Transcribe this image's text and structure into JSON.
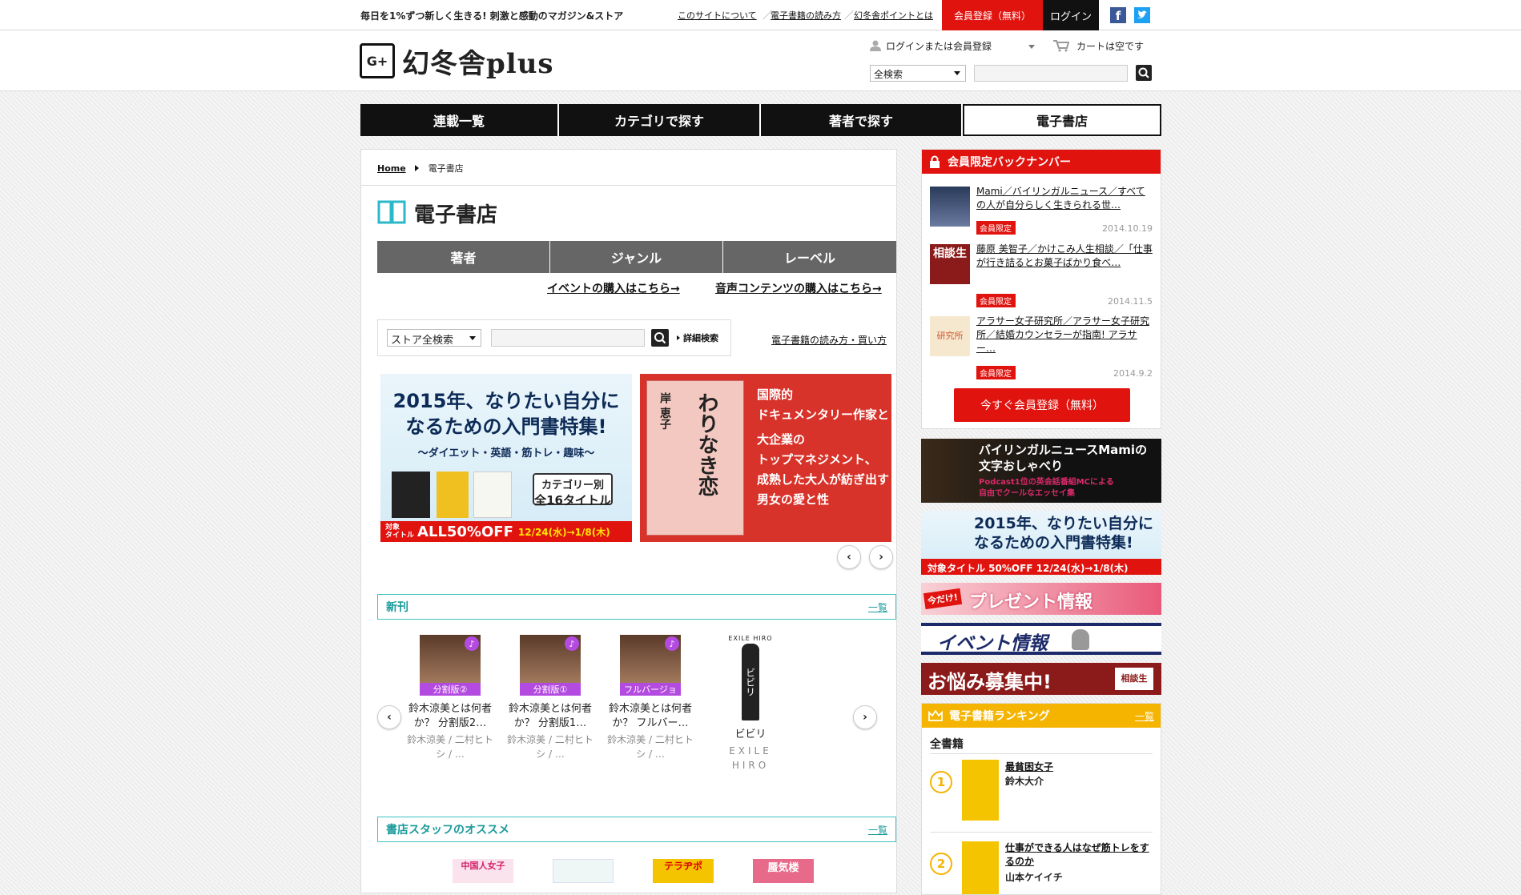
{
  "topbar": {
    "tagline": "毎日を1%ずつ新しく生きる! 刺激と感動のマガジン&ストア",
    "links": [
      "このサイトについて",
      "電子書籍の読み方",
      "幻冬舎ポイントとは"
    ],
    "register": "会員登録（無料）",
    "login": "ログイン"
  },
  "header": {
    "logo_text": "幻冬舎plus",
    "logo_mark": "G+",
    "user_menu": "ログインまたは会員登録",
    "cart": "カートは空です",
    "search_scope": "全検索",
    "search_value": ""
  },
  "nav": {
    "items": [
      "連載一覧",
      "カテゴリで探す",
      "著者で探す",
      "電子書店"
    ],
    "active": 3
  },
  "breadcrumb": {
    "home": "Home",
    "current": "電子書店"
  },
  "page": {
    "title": "電子書店",
    "tabs": [
      "著者",
      "ジャンル",
      "レーベル"
    ],
    "event_link": "イベントの購入はこちら→",
    "audio_link": "音声コンテンツの購入はこちら→",
    "store_search_scope": "ストア全検索",
    "store_search_value": "",
    "advanced_search": "詳細検索",
    "howto_link": "電子書籍の読み方・買い方"
  },
  "carousel": {
    "banner1": {
      "line1": "2015年、なりたい自分に",
      "line2": "なるための入門書特集!",
      "line3": "～ダイエット・英語・筋トレ・趣味～",
      "badge1": "カテゴリー別",
      "badge2": "全16タイトル",
      "sale_left1": "対象",
      "sale_left2": "タイトル",
      "sale": "ALL50%OFF",
      "dates": "12/24(水)→1/8(木)"
    },
    "banner2": {
      "author": "岸 恵子",
      "book": "わりなき恋",
      "lines": [
        "国際的",
        "ドキュメンタリー作家と",
        "大企業の",
        "トップマネジメント、",
        "成熟した大人が紡ぎ出す",
        "男女の愛と性"
      ]
    }
  },
  "shinkan": {
    "title": "新刊",
    "more": "一覧",
    "books": [
      {
        "label": "分割版②",
        "title": "鈴木涼美とは何者か？ 分割版2…",
        "author": "鈴木涼美 / 二村ヒトシ / …"
      },
      {
        "label": "分割版①",
        "title": "鈴木涼美とは何者か？ 分割版1…",
        "author": "鈴木涼美 / 二村ヒトシ / …"
      },
      {
        "label": "フルバージョン",
        "title": "鈴木涼美とは何者か？ フルバー…",
        "author": "鈴木涼美 / 二村ヒトシ / …"
      },
      {
        "label": "",
        "title": "ビビリ",
        "author": "EXILE HIRO",
        "cover_brand": "EXILE HIRO",
        "cover_title": "ビビリ"
      }
    ]
  },
  "staff": {
    "title": "書店スタッフのオススメ",
    "more": "一覧",
    "covers": [
      "中国人女子",
      "",
      "テラヂポ",
      "蜃気楼"
    ]
  },
  "sidebar": {
    "backnumber_title": "会員限定バックナンバー",
    "items": [
      {
        "title": "Mami／バイリンガルニュース／すべての人が自分らしく生きられる世…",
        "badge": "会員限定",
        "date": "2014.10.19"
      },
      {
        "title": "藤原 美智子／かけこみ人生相談／「仕事が行き詰るとお菓子ばかり食べ…",
        "badge": "会員限定",
        "date": "2014.11.5",
        "thumb_text": "相談生"
      },
      {
        "title": "アラサー女子研究所／アラサー女子研究所／結婚カウンセラーが指南! アラサー…",
        "badge": "会員限定",
        "date": "2014.9.2",
        "thumb_text": "研究所"
      }
    ],
    "register_button": "今すぐ会員登録（無料）",
    "banner_mami": {
      "line1": "バイリンガルニュースMamiの",
      "line2": "文字おしゃべり",
      "line3": "Podcast1位の英会話番組MCによる",
      "line4": "自由でクールなエッセイ集"
    },
    "banner_nyumon": {
      "line1": "2015年、なりたい自分に",
      "line2": "なるための入門書特集!",
      "sale": "対象タイトル 50%OFF 12/24(水)→1/8(木)"
    },
    "banner_present": {
      "tag": "今だけ!",
      "text": "プレゼント情報"
    },
    "banner_event": {
      "text": "イベント情報"
    },
    "banner_nayami": {
      "text": "お悩み募集中!",
      "tag": "相談生"
    },
    "ranking_title": "電子書籍ランキング",
    "ranking_more": "一覧",
    "ranking_category": "全書籍",
    "ranking": [
      {
        "rank": "1",
        "title": "最貧困女子",
        "author": "鈴木大介"
      },
      {
        "rank": "2",
        "title": "仕事ができる人はなぜ筋トレをするのか",
        "author": "山本ケイイチ"
      }
    ]
  },
  "colors": {
    "accent_red": "#e0130f",
    "teal": "#3fc4c4",
    "nav_black": "#111111",
    "ranking_yellow": "#f5b400"
  }
}
